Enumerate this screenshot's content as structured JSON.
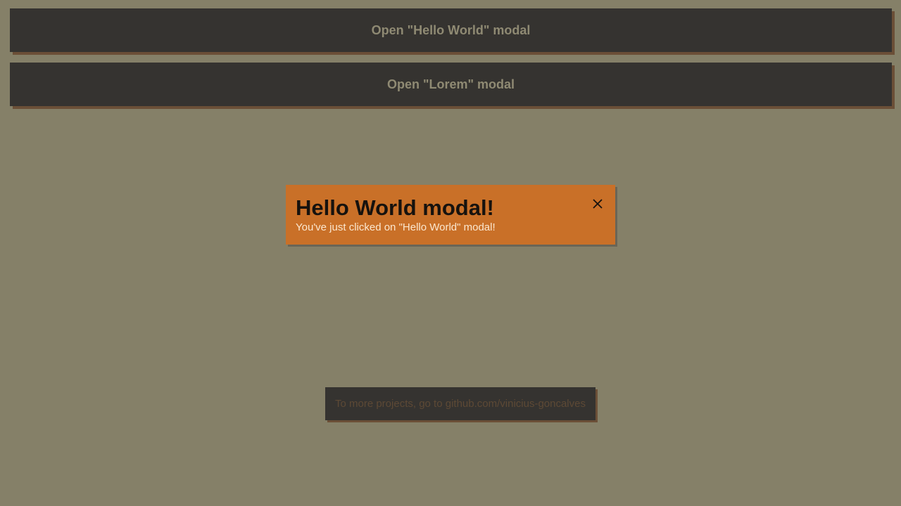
{
  "buttons": {
    "hello_label": "Open \"Hello World\" modal",
    "lorem_label": "Open \"Lorem\" modal"
  },
  "modal": {
    "title": "Hello World modal!",
    "text": "You've just clicked on \"Hello World\" modal!",
    "close_icon": "close-icon"
  },
  "footer": {
    "text": "To more projects, go to github.com/vinicius-goncalves"
  },
  "colors": {
    "background": "#858068",
    "button_bg": "#353330",
    "button_text": "#8f8a73",
    "button_shadow": "#6b4f37",
    "modal_bg": "#c97028",
    "modal_title": "#16120e",
    "modal_text": "#fbe7cf"
  }
}
